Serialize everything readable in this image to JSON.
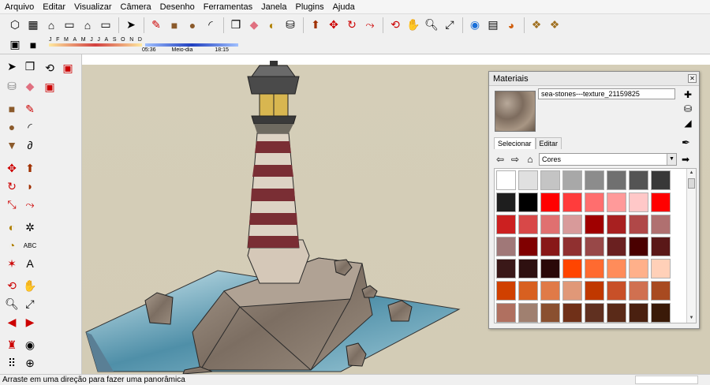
{
  "menu": [
    "Arquivo",
    "Editar",
    "Visualizar",
    "Câmera",
    "Desenho",
    "Ferramentas",
    "Janela",
    "Plugins",
    "Ajuda"
  ],
  "shadow": {
    "months": [
      "J",
      "F",
      "M",
      "A",
      "M",
      "J",
      "J",
      "A",
      "S",
      "O",
      "N",
      "D"
    ],
    "time_start": "05:36",
    "time_mid": "Meio-dia",
    "time_end": "18:15"
  },
  "status": {
    "text": "Arraste em uma direção para fazer uma panorâmica"
  },
  "materials": {
    "title": "Materiais",
    "material_name": "sea-stones---texture_21159825",
    "tab_select": "Selecionar",
    "tab_edit": "Editar",
    "library": "Cores",
    "swatches": [
      "#ffffff",
      "#e0e0e0",
      "#c4c4c4",
      "#a8a8a8",
      "#8c8c8c",
      "#707070",
      "#545454",
      "#383838",
      "#1e1e1e",
      "#000000",
      "#ff0000",
      "#ff3c3c",
      "#ff6e6e",
      "#ff9a9a",
      "#ffc8c8",
      "#ff0000",
      "#cc2020",
      "#d84848",
      "#e07070",
      "#d89a9a",
      "#a00000",
      "#a82020",
      "#b04848",
      "#b07070",
      "#a07878",
      "#800000",
      "#881818",
      "#903030",
      "#984848",
      "#6a2020",
      "#4a0000",
      "#5a1818",
      "#3a1818",
      "#2e1010",
      "#2a0808",
      "#ff4500",
      "#ff6a30",
      "#ff8c5a",
      "#ffb08a",
      "#ffd0b8",
      "#d04000",
      "#d86020",
      "#e07a48",
      "#e09878",
      "#c03800",
      "#c85028",
      "#d07050",
      "#a84a20",
      "#b07060",
      "#a08070",
      "#8a5030",
      "#703018",
      "#603020",
      "#5a2a18",
      "#4a2010",
      "#3a1a08"
    ]
  }
}
